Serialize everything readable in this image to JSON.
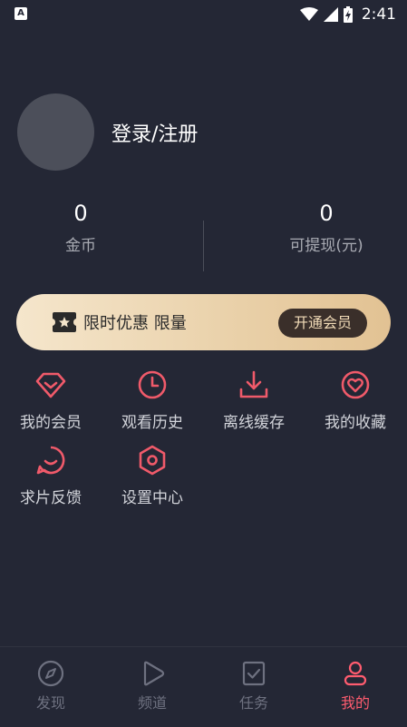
{
  "status_bar": {
    "time": "2:41"
  },
  "profile": {
    "login_label": "登录/注册"
  },
  "stats": [
    {
      "value": "0",
      "label": "金币"
    },
    {
      "value": "0",
      "label": "可提现(元)"
    }
  ],
  "vip_banner": {
    "text": "限时优惠 限量",
    "button": "开通会员"
  },
  "menu": [
    {
      "label": "我的会员",
      "icon": "diamond-icon"
    },
    {
      "label": "观看历史",
      "icon": "clock-icon"
    },
    {
      "label": "离线缓存",
      "icon": "download-icon"
    },
    {
      "label": "我的收藏",
      "icon": "heart-icon"
    },
    {
      "label": "求片反馈",
      "icon": "chat-smile-icon"
    },
    {
      "label": "设置中心",
      "icon": "hexagon-settings-icon"
    }
  ],
  "tabs": [
    {
      "label": "发现",
      "icon": "compass-icon"
    },
    {
      "label": "频道",
      "icon": "play-icon"
    },
    {
      "label": "任务",
      "icon": "task-check-icon"
    },
    {
      "label": "我的",
      "icon": "person-icon",
      "active": true
    }
  ],
  "colors": {
    "background": "#242735",
    "accent": "#ff5c6f",
    "icon_red": "#f05a6a"
  }
}
